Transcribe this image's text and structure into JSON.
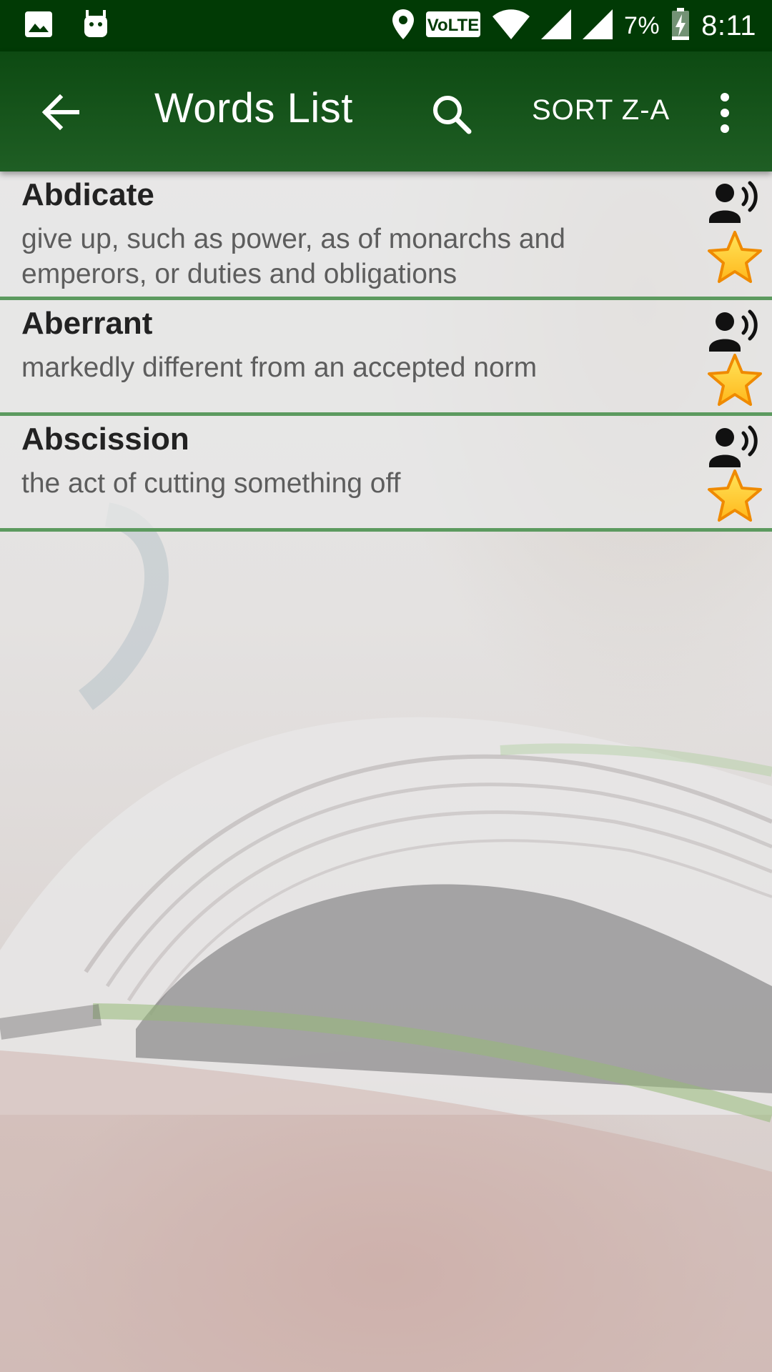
{
  "status_bar": {
    "time": "8:11",
    "battery_percent": "7%",
    "network_label": "VoLTE",
    "icons": [
      "image-icon",
      "android-icon",
      "location-icon",
      "volte-icon",
      "wifi-icon",
      "signal-icon",
      "signal-icon",
      "battery-charging-icon"
    ]
  },
  "app_bar": {
    "title": "Words List",
    "sort_label": "SORT Z-A",
    "icons": [
      "back-arrow-icon",
      "search-icon",
      "more-vert-icon"
    ],
    "background_color": "#1b5e20"
  },
  "words": [
    {
      "word": "Abdicate",
      "meaning": "give up, such as power, as of monarchs and emperors, or duties and obligations"
    },
    {
      "word": "Aberrant",
      "meaning": "markedly different from an accepted norm"
    },
    {
      "word": "Abscission",
      "meaning": "the act of cutting something off"
    }
  ],
  "row_icons": [
    "speaker-person-icon",
    "star-icon"
  ],
  "colors": {
    "divider": "#5c9a5f",
    "star_fill": "#ffd21f",
    "star_outline": "#ef8a00"
  }
}
